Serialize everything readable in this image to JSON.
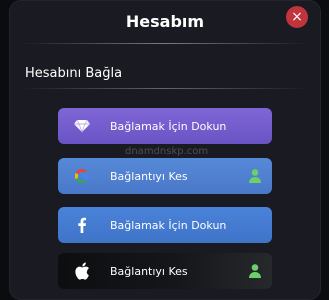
{
  "dialog": {
    "title": "Hesabım",
    "close_icon": "×",
    "section_title": "Hesabını Bağla"
  },
  "buttons": [
    {
      "name": "diamond",
      "label": "Bağlamak İçin Dokun",
      "linked": false
    },
    {
      "name": "google",
      "label": "Bağlantıyı Kes",
      "linked": true
    },
    {
      "name": "facebook",
      "label": "Bağlamak İçin Dokun",
      "linked": false
    },
    {
      "name": "apple",
      "label": "Bağlantıyı Kes",
      "linked": true
    }
  ],
  "watermark": "dnamdnskp.com",
  "colors": {
    "dialog_bg": "#1a1b22",
    "close_red": "#c0343b",
    "diamond_purple": "#7f66d6",
    "google_blue": "#5789d9",
    "facebook_blue": "#4a83da",
    "apple_dark": "#15161a",
    "linked_green": "#6ccf6a"
  }
}
